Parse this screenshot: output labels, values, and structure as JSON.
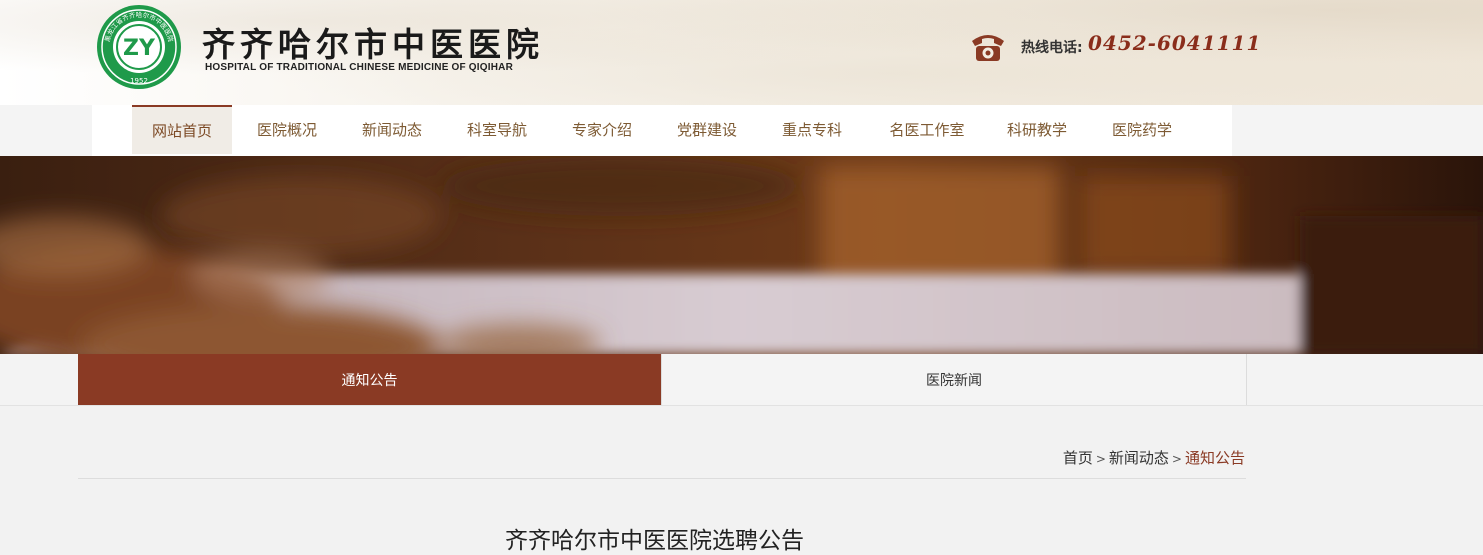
{
  "header": {
    "title": "齐齐哈尔市中医医院",
    "subtitle": "HOSPITAL OF TRADITIONAL CHINESE MEDICINE OF QIQIHAR",
    "logo_text": "ZY",
    "logo_year": "1952",
    "logo_ring_text": "黑龙江省齐齐哈尔市中医医院",
    "hotline_label": "热线电话:",
    "hotline_number": "0452-6041111",
    "icons": [
      "hospital-logo-icon",
      "telephone-icon"
    ]
  },
  "nav": {
    "items": [
      {
        "label": "网站首页",
        "active": true
      },
      {
        "label": "医院概况"
      },
      {
        "label": "新闻动态"
      },
      {
        "label": "科室导航"
      },
      {
        "label": "专家介绍"
      },
      {
        "label": "党群建设"
      },
      {
        "label": "重点专科"
      },
      {
        "label": "名医工作室"
      },
      {
        "label": "科研教学"
      },
      {
        "label": "医院药学"
      }
    ]
  },
  "tabs": [
    {
      "label": "通知公告",
      "active": true
    },
    {
      "label": "医院新闻"
    }
  ],
  "breadcrumb": {
    "home": "首页",
    "sep": ">",
    "section": "新闻动态",
    "current": "通知公告"
  },
  "article": {
    "title": "齐齐哈尔市中医医院选聘公告"
  },
  "colors": {
    "brand": "#8a3a24",
    "logo_green": "#1f9a4a",
    "nav_text": "#7d5a33"
  }
}
